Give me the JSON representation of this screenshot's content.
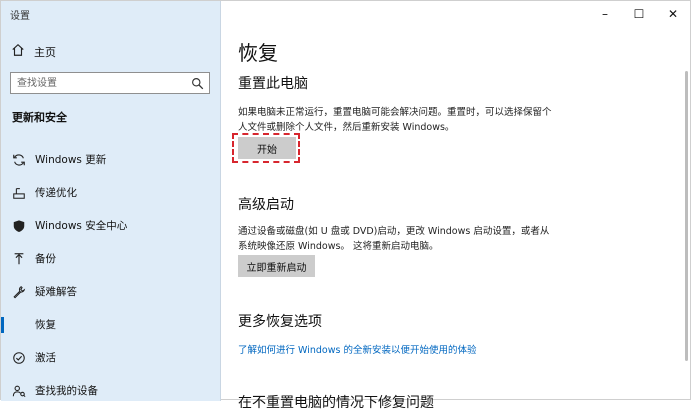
{
  "window": {
    "title": "设置",
    "minimize_glyph": "–",
    "maximize_glyph": "☐",
    "close_glyph": "✕"
  },
  "sidebar": {
    "home_label": "主页",
    "search_placeholder": "查找设置",
    "section_title": "更新和安全",
    "items": [
      {
        "label": "Windows 更新",
        "icon": "sync-icon"
      },
      {
        "label": "传递优化",
        "icon": "delivery-optimization-icon"
      },
      {
        "label": "Windows 安全中心",
        "icon": "shield-icon"
      },
      {
        "label": "备份",
        "icon": "backup-arrow-icon"
      },
      {
        "label": "疑难解答",
        "icon": "wrench-icon"
      },
      {
        "label": "恢复",
        "icon": "recovery-icon",
        "active": true
      },
      {
        "label": "激活",
        "icon": "activation-check-icon"
      },
      {
        "label": "查找我的设备",
        "icon": "person-locate-icon"
      }
    ]
  },
  "main": {
    "title": "恢复",
    "reset": {
      "heading": "重置此电脑",
      "description": "如果电脑未正常运行，重置电脑可能会解决问题。重置时，可以选择保留个人文件或删除个人文件，然后重新安装 Windows。",
      "button": "开始"
    },
    "advanced": {
      "heading": "高级启动",
      "description": "通过设备或磁盘(如 U 盘或 DVD)启动，更改 Windows 启动设置，或者从系统映像还原 Windows。 这将重新启动电脑。",
      "button": "立即重新启动"
    },
    "more": {
      "heading": "更多恢复选项",
      "link": "了解如何进行 Windows 的全新安装以便开始使用的体验"
    },
    "partial_heading": "在不重置电脑的情况下修复问题"
  },
  "colors": {
    "sidebar_bg": "#dfecf8",
    "accent": "#0067c0",
    "highlight_dash": "#d7262e",
    "button_bg": "#cccccc"
  }
}
